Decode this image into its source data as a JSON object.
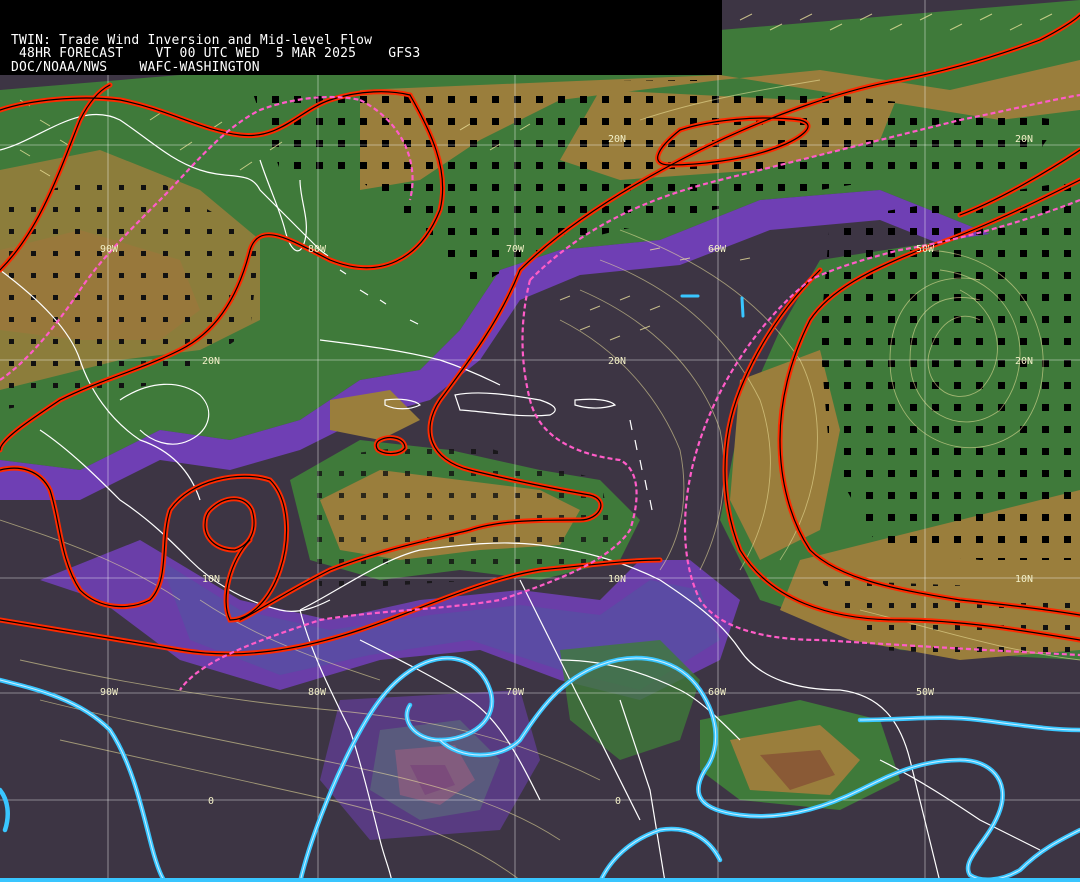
{
  "header": {
    "line1": "TWIN: Trade Wind Inversion and Mid-level Flow",
    "line2": " 48HR FORECAST    VT 00 UTC WED  5 MAR 2025    GFS3",
    "line3": "DOC/NOAA/NWS    WAFC-WASHINGTON"
  },
  "grid_labels": {
    "lon": [
      "90W",
      "80W",
      "70W",
      "60W",
      "50W"
    ],
    "lat": [
      "20N",
      "10N",
      "0"
    ]
  },
  "colors": {
    "background": "#3d3544",
    "shade_purple": "#7a44c0",
    "shade_blue": "#4e55a0",
    "shade_green": "#3f7a3a",
    "shade_tan": "#9a7e3c",
    "shade_brown": "#8a5a36",
    "inversion_contour": "#ff2a00",
    "dashed_contour": "#ff5cc8",
    "cyan_contour": "#39c6ff",
    "flow_lines": "#f3e8a0",
    "coastline": "#ffffff"
  }
}
